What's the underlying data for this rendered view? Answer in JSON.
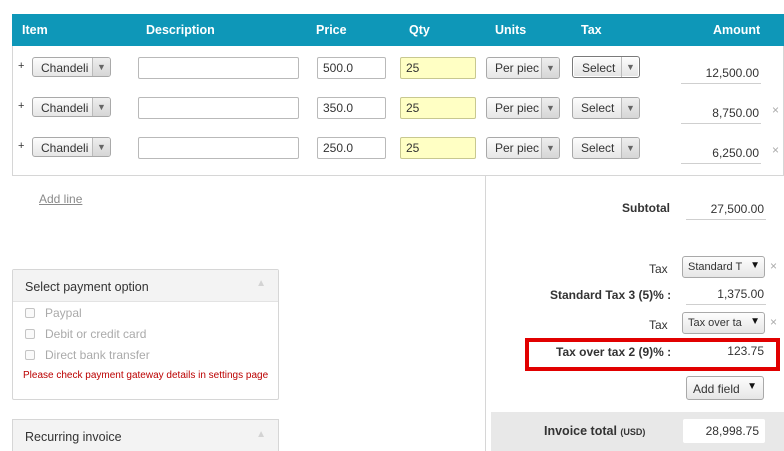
{
  "table": {
    "headers": {
      "item": "Item",
      "description": "Description",
      "price": "Price",
      "qty": "Qty",
      "units": "Units",
      "tax": "Tax",
      "amount": "Amount"
    },
    "rows": [
      {
        "plus": "+",
        "item": "Chandeli",
        "description": "",
        "price": "500.0",
        "qty": "25",
        "units": "Per piec",
        "tax": "Select",
        "amount": "12,500.00",
        "remove": ""
      },
      {
        "plus": "+",
        "item": "Chandeli",
        "description": "",
        "price": "350.0",
        "qty": "25",
        "units": "Per piec",
        "tax": "Select",
        "amount": "8,750.00",
        "remove": "×"
      },
      {
        "plus": "+",
        "item": "Chandeli",
        "description": "",
        "price": "250.0",
        "qty": "25",
        "units": "Per piec",
        "tax": "Select",
        "amount": "6,250.00",
        "remove": "×"
      }
    ],
    "add_line": "Add line"
  },
  "payment": {
    "title": "Select payment option",
    "options": [
      "Paypal",
      "Debit or credit card",
      "Direct bank transfer"
    ],
    "warning": "Please check payment gateway details in settings page"
  },
  "recurring": {
    "title": "Recurring invoice"
  },
  "summary": {
    "subtotal_label": "Subtotal",
    "subtotal_value": "27,500.00",
    "tax1_label": "Tax",
    "tax1_select": "Standard T",
    "tax1_line_label": "Standard Tax 3 (5)% :",
    "tax1_value": "1,375.00",
    "tax2_label": "Tax",
    "tax2_select": "Tax over ta",
    "tax2_line_label": "Tax over tax 2 (9)% :",
    "tax2_value": "123.75",
    "add_field": "Add field",
    "total_label": "Invoice total",
    "total_currency": "(USD)",
    "total_value": "28,998.75"
  },
  "icons": {
    "remove": "×",
    "dropdown": "▼",
    "caret_up": "▲"
  },
  "colors": {
    "header_bg": "#0e97b8",
    "qty_bg": "#ffffc4",
    "highlight": "#e10000",
    "warning": "#bb0000"
  }
}
